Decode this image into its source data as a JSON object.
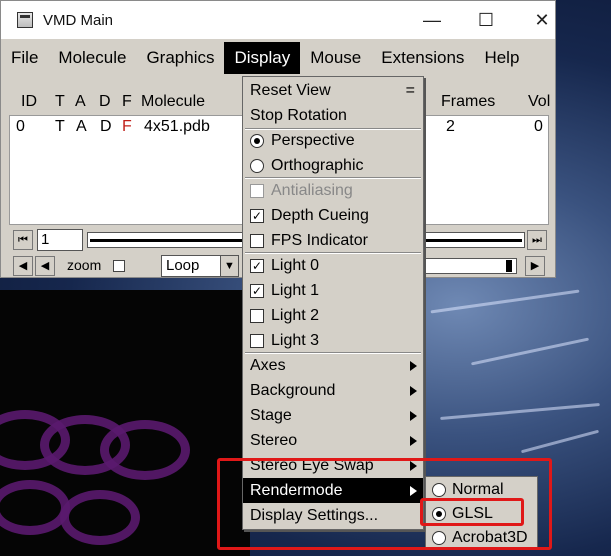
{
  "window": {
    "title": "VMD Main",
    "minimize_glyph": "—",
    "maximize_glyph": "☐",
    "close_glyph": "✕"
  },
  "menubar": [
    "File",
    "Molecule",
    "Graphics",
    "Display",
    "Mouse",
    "Extensions",
    "Help"
  ],
  "active_menu": "Display",
  "molecule_table": {
    "headers": {
      "id": "ID",
      "t": "T",
      "a": "A",
      "d": "D",
      "f": "F",
      "molecule": "Molecule",
      "frames": "Frames",
      "vol": "Vol"
    },
    "rows": [
      {
        "id": "0",
        "t": "T",
        "a": "A",
        "d": "D",
        "f": "F",
        "molecule": "4x51.pdb",
        "frames": "2",
        "vol": "0"
      }
    ]
  },
  "controls": {
    "frame_value": "1",
    "zoom_label": "zoom",
    "loop_value": "Loop"
  },
  "display_menu": {
    "reset_view": "Reset View",
    "reset_view_shortcut": "=",
    "stop_rotation": "Stop Rotation",
    "perspective": "Perspective",
    "orthographic": "Orthographic",
    "antialiasing": "Antialiasing",
    "depth_cueing": "Depth Cueing",
    "fps_indicator": "FPS Indicator",
    "light0": "Light 0",
    "light1": "Light 1",
    "light2": "Light 2",
    "light3": "Light 3",
    "axes": "Axes",
    "background": "Background",
    "stage": "Stage",
    "stereo": "Stereo",
    "stereo_eye_swap": "Stereo Eye Swap",
    "rendermode": "Rendermode",
    "display_settings": "Display Settings..."
  },
  "rendermode_menu": {
    "normal": "Normal",
    "glsl": "GLSL",
    "acrobat3d": "Acrobat3D",
    "selected": "GLSL"
  },
  "colors": {
    "highlight_bg": "#000000",
    "annotation_red": "#e01818",
    "molecule_f_red": "#c0201a"
  }
}
